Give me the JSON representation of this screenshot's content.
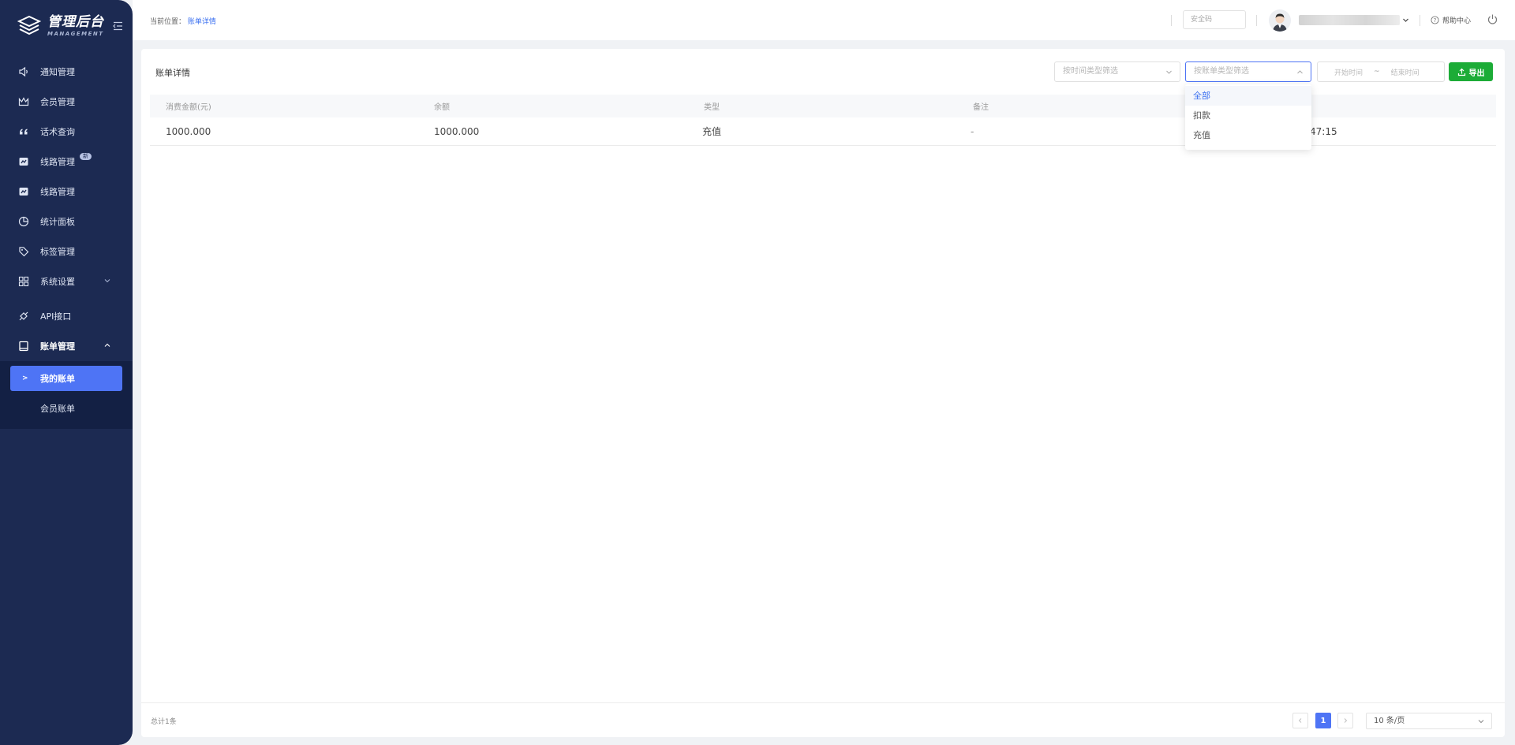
{
  "brand": {
    "title": "管理后台",
    "subtitle": "MANAGEMENT"
  },
  "sidebar": {
    "items": [
      {
        "label": "通知管理",
        "icon": "speaker-icon"
      },
      {
        "label": "会员管理",
        "icon": "crown-icon"
      },
      {
        "label": "话术查询",
        "icon": "quote-icon"
      },
      {
        "label": "线路管理",
        "icon": "route-icon",
        "badge": "新"
      },
      {
        "label": "线路管理",
        "icon": "route-icon"
      },
      {
        "label": "统计面板",
        "icon": "pie-chart-icon"
      },
      {
        "label": "标签管理",
        "icon": "tag-icon"
      },
      {
        "label": "系统设置",
        "icon": "grid-icon"
      },
      {
        "label": "API接口",
        "icon": "plug-icon"
      },
      {
        "label": "账单管理",
        "icon": "book-icon"
      }
    ],
    "submenu": [
      {
        "label": "我的账单",
        "active": true
      },
      {
        "label": "会员账单",
        "active": false
      }
    ]
  },
  "topbar": {
    "breadcrumb_prefix": "当前位置：",
    "breadcrumb_current": "账单详情",
    "security_placeholder": "安全码",
    "help_label": "帮助中心"
  },
  "card": {
    "title": "账单详情",
    "time_filter_placeholder": "按时间类型筛选",
    "type_filter_placeholder": "按账单类型筛选",
    "start_placeholder": "开始时间",
    "range_sep": "~",
    "end_placeholder": "结束时间",
    "export_label": "导出"
  },
  "table": {
    "headers": [
      "消费金额(元)",
      "余额",
      "类型",
      "备注"
    ],
    "rows": [
      {
        "amount": "1000.000",
        "balance": "1000.000",
        "type": "充值",
        "note": "-",
        "time_fragment": "47:15"
      }
    ]
  },
  "dropdown": {
    "options": [
      "全部",
      "扣款",
      "充值"
    ],
    "selected": "全部"
  },
  "footer": {
    "total": "总计1条",
    "page": "1",
    "page_size": "10 条/页"
  },
  "colors": {
    "sidebar_bg": "#1c2a52",
    "accent": "#4e74f5",
    "export_green": "#1cac37"
  }
}
